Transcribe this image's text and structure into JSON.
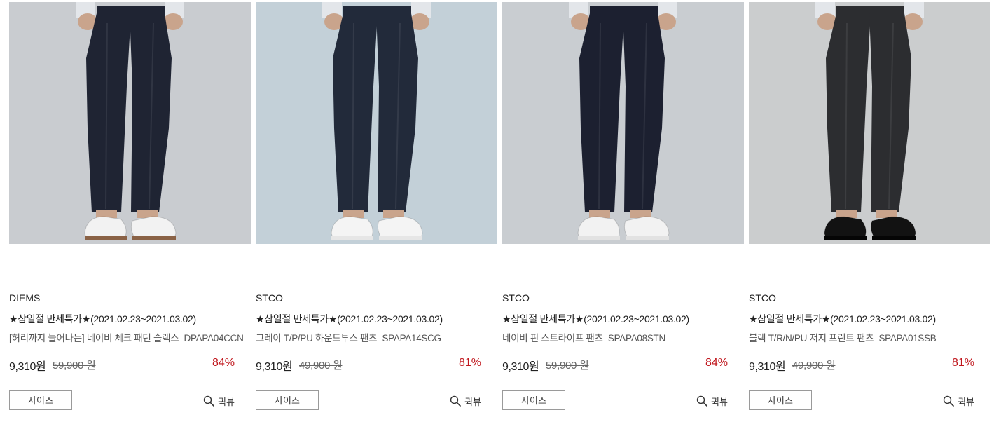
{
  "products": [
    {
      "brand": "DIEMS",
      "promo": "★삼일절 만세특가★(2021.02.23~2021.03.02)",
      "name": "[허리까지 늘어나는] 네이비 체크 패턴 슬랙스_DPAPA04CCN",
      "sale_price": "9,310원",
      "original_price": "59,900 원",
      "discount": "84%",
      "size_label": "사이즈",
      "quickview_label": "퀵뷰",
      "image": {
        "background": "#c9ccd0",
        "pants_color": "#1f2433",
        "shoe_color": "#f2f2f2",
        "sole_color": "#8a6246"
      }
    },
    {
      "brand": "STCO",
      "promo": "★삼일절 만세특가★(2021.02.23~2021.03.02)",
      "name": "그레이 T/P/PU 하운드투스 팬츠_SPAPA14SCG",
      "sale_price": "9,310원",
      "original_price": "49,900 원",
      "discount": "81%",
      "size_label": "사이즈",
      "quickview_label": "퀵뷰",
      "image": {
        "background": "#c3d0d8",
        "pants_color": "#222a3a",
        "shoe_color": "#f4f4f4",
        "sole_color": "#e6e6e6"
      }
    },
    {
      "brand": "STCO",
      "promo": "★삼일절 만세특가★(2021.02.23~2021.03.02)",
      "name": "네이비 핀 스트라이프 팬츠_SPAPA08STN",
      "sale_price": "9,310원",
      "original_price": "59,900 원",
      "discount": "84%",
      "size_label": "사이즈",
      "quickview_label": "퀵뷰",
      "image": {
        "background": "#c9cdd1",
        "pants_color": "#1c2030",
        "shoe_color": "#f2f2f2",
        "sole_color": "#e2e2e2"
      }
    },
    {
      "brand": "STCO",
      "promo": "★삼일절 만세특가★(2021.02.23~2021.03.02)",
      "name": "블랙 T/R/N/PU 저지 프린트 팬츠_SPAPA01SSB",
      "sale_price": "9,310원",
      "original_price": "49,900 원",
      "discount": "81%",
      "size_label": "사이즈",
      "quickview_label": "퀵뷰",
      "image": {
        "background": "#cbcdce",
        "pants_color": "#2c2d30",
        "shoe_color": "#121212",
        "sole_color": "#050505"
      }
    }
  ],
  "icons": {
    "quickview": "magnifier-icon"
  },
  "colors": {
    "discount": "#c0161c",
    "text": "#222222",
    "muted": "#666666"
  }
}
